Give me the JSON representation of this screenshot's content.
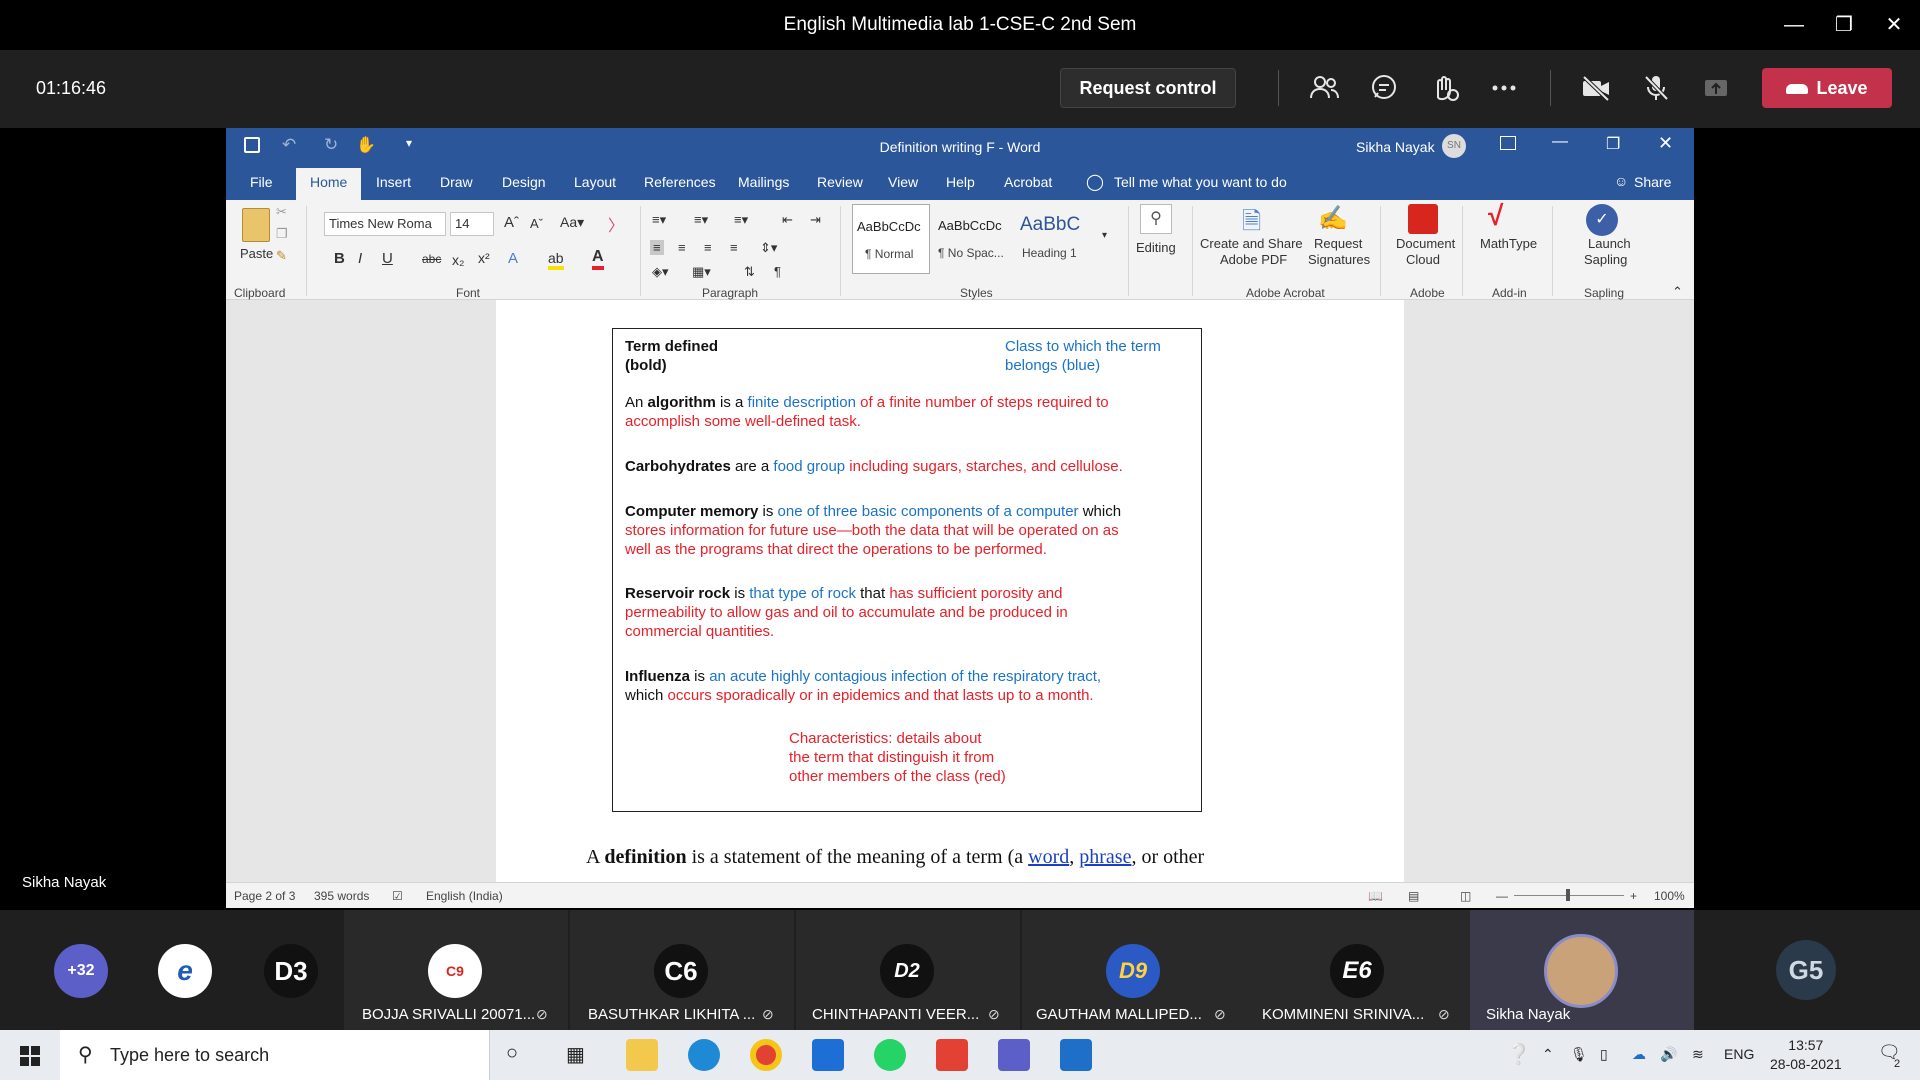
{
  "teams": {
    "window_title": "English Multimedia lab 1-CSE-C 2nd Sem",
    "timer": "01:16:46",
    "request_control": "Request control",
    "leave": "Leave",
    "presenter_name": "Sikha Nayak"
  },
  "word": {
    "title": "Definition writing F  -  Word",
    "user_name": "Sikha Nayak",
    "user_initials": "SN",
    "tabs": [
      "File",
      "Home",
      "Insert",
      "Draw",
      "Design",
      "Layout",
      "References",
      "Mailings",
      "Review",
      "View",
      "Help",
      "Acrobat"
    ],
    "tell_me": "Tell me what you want to do",
    "share": "Share",
    "ribbon": {
      "paste": "Paste",
      "clipboard": "Clipboard",
      "font_name": "Times New Roma",
      "font_size": "14",
      "font_group": "Font",
      "paragraph_group": "Paragraph",
      "styles_group": "Styles",
      "style_normal_preview": "AaBbCcDc",
      "style_normal": "¶ Normal",
      "style_nospace_preview": "AaBbCcDc",
      "style_nospace": "¶ No Spac...",
      "style_heading_preview": "AaBbC",
      "style_heading": "Heading 1",
      "editing": "Editing",
      "create_share_1": "Create and Share",
      "create_share_2": "Adobe PDF",
      "request_sig_1": "Request",
      "request_sig_2": "Signatures",
      "adobe_acrobat_group": "Adobe Acrobat",
      "doc_cloud_1": "Document",
      "doc_cloud_2": "Cloud",
      "adobe_group": "Adobe",
      "mathtype": "MathType",
      "addin_group": "Add-in",
      "launch_1": "Launch",
      "launch_2": "Sapling",
      "sapling_group": "Sapling"
    },
    "box": {
      "header_left_1": "Term defined",
      "header_left_2": "(bold)",
      "header_right_1": "Class to which the term",
      "header_right_2": "belongs (blue)",
      "def1": {
        "pre": "An ",
        "term": "algorithm",
        "mid": " is a ",
        "cls": "finite description",
        "rest_1": " of a  finite  number of steps  required to",
        "rest_2": "accomplish  some  well-defined task."
      },
      "def2": {
        "term": "Carbohydrates",
        "mid": " are a ",
        "cls": "food group",
        "rest": " including  sugars,  starches,  and cellulose."
      },
      "def3": {
        "term": "Computer memory",
        "mid": "  is ",
        "cls": "one  of three  basic  components  of a  computer",
        "tail": " which",
        "rest_1": "stores information  for future use—both the data  that will be operated  on as",
        "rest_2": "well as the programs  that direct the operations  to be performed."
      },
      "def4": {
        "term": "Reservoir rock",
        "mid": " is ",
        "cls": "that  type  of rock",
        "tail": " that ",
        "rest_1": "has  sufficient porosity and",
        "rest_2": "permeability  to allow  gas  and oil to accumulate  and be produced in",
        "rest_3": "commercial  quantities."
      },
      "def5": {
        "term": "Influenza",
        "mid": " is ",
        "cls": "an  acute  highly contagious  infection of the respiratory tract,",
        "pre2": "which ",
        "rest": "occurs sporadically  or in epidemics  and that lasts up to a month."
      },
      "char_1": "Characteristics:  details  about",
      "char_2": "the term that distinguish it from",
      "char_3": "other members  of the class  (red)"
    },
    "body": {
      "a": "A ",
      "definition": "definition",
      "mid": " is a statement of the meaning of a term (a ",
      "word": "word",
      "comma": ", ",
      "phrase": "phrase",
      "end": ", or other"
    },
    "status": {
      "page": "Page 2 of 3",
      "words": "395 words",
      "language": "English (India)",
      "zoom": "100%"
    }
  },
  "participants": [
    {
      "label": "+32"
    },
    {
      "label": "e"
    },
    {
      "label": "D3"
    },
    {
      "initials": "C9",
      "name": "BOJJA SRIVALLI 20071..."
    },
    {
      "initials": "C6",
      "name": "BASUTHKAR LIKHITA ..."
    },
    {
      "initials": "D2",
      "name": "CHINTHAPANTI VEER..."
    },
    {
      "initials": "D9",
      "name": "GAUTHAM MALLIPED..."
    },
    {
      "initials": "E6",
      "name": "KOMMINENI SRINIVA..."
    },
    {
      "initials": "",
      "name": "Sikha Nayak"
    },
    {
      "label": "G5"
    }
  ],
  "taskbar": {
    "search_placeholder": "Type here to search",
    "lang": "ENG",
    "time": "13:57",
    "date": "28-08-2021",
    "notif_count": "2"
  },
  "colors": {
    "word_blue": "#2b579a",
    "leave_red": "#c4314b",
    "class_blue": "#1a73c8",
    "characteristic_red": "#e8202a"
  }
}
